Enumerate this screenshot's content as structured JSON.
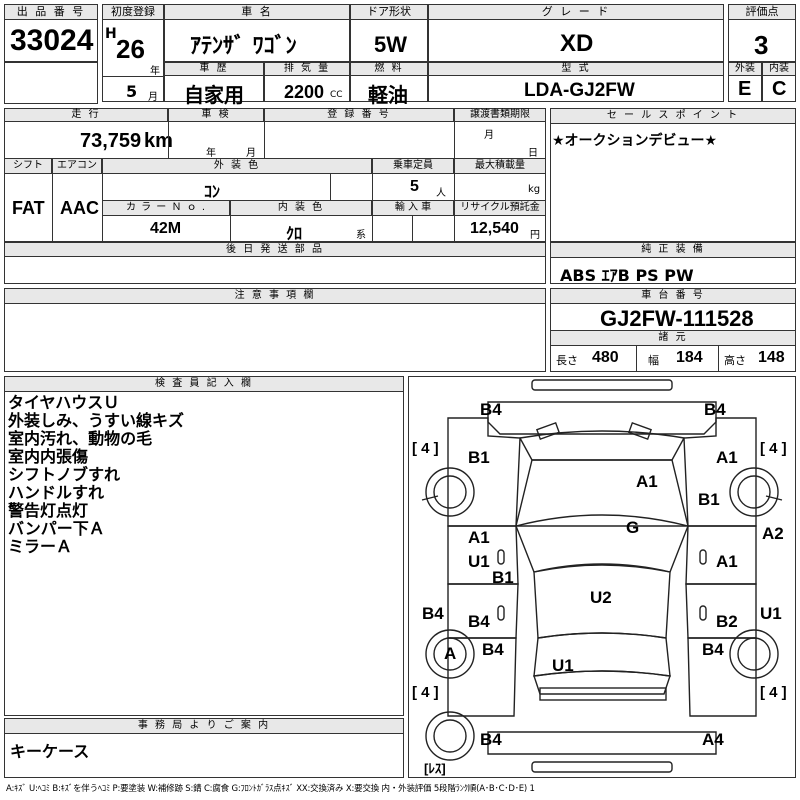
{
  "header": {
    "lot_label": "出 品 番 号",
    "lot": "33024",
    "first_reg_label": "初度登録",
    "era": "H",
    "year": "26",
    "year_unit": "年",
    "month": "5",
    "month_unit": "月",
    "car_name_label": "車 名",
    "car_name": "ｱﾃﾝｻﾞ ﾜｺﾞﾝ",
    "door_label": "ドア形状",
    "door": "5W",
    "grade_label": "グ レ ー ド",
    "grade": "XD",
    "score_label": "評価点",
    "score": "3",
    "history_label": "車 歴",
    "history": "自家用",
    "displacement_label": "排 気 量",
    "displacement": "2200",
    "displacement_unit": "CC",
    "fuel_label": "燃 料",
    "fuel": "軽油",
    "model_label": "型 式",
    "model": "LDA-GJ2FW",
    "ext_label": "外装",
    "ext": "E",
    "int_label": "内装",
    "int": "C"
  },
  "row2": {
    "mileage_label": "走 行",
    "mileage": "73,759",
    "mileage_unit": "km",
    "inspection_label": "車 検",
    "insp_year": "年",
    "insp_month": "月",
    "reg_no_label": "登 録 番 号",
    "transfer_label": "譲渡書類期限",
    "transfer_month": "月",
    "transfer_day": "日",
    "sales_point_label": "セ ー ル ス ポ イ ン ト",
    "sales_point": "★オークションデビュー★",
    "shift_label": "シフト",
    "shift": "FAT",
    "ac_label": "エアコン",
    "ac": "AAC",
    "color_label": "外 装 色",
    "color": "ｺﾝ",
    "capacity_label": "乗車定員",
    "capacity": "5",
    "capacity_unit": "人",
    "load_label": "最大積載量",
    "load_unit": "kg",
    "color_no_label": "カ ラ ー Ｎ ｏ .",
    "color_no": "42M",
    "int_color_label": "内 装 色",
    "int_color": "ｸﾛ",
    "int_color_unit": "系",
    "import_label": "輸 入 車",
    "recycle_label": "リサイクル預託金",
    "recycle": "12,540",
    "recycle_unit": "円"
  },
  "later_parts_label": "後 日 発 送 部 品",
  "equipment_label": "純 正 装 備",
  "equipment": "ABS ｴｱB PS PW",
  "caution_label": "注 意 事 項 欄",
  "chassis_label": "車 台 番 号",
  "chassis": "GJ2FW-111528",
  "dims": {
    "label": "諸 元",
    "length_label": "長さ",
    "length": "480",
    "width_label": "幅",
    "width": "184",
    "height_label": "高さ",
    "height": "148"
  },
  "inspector_label": "検 査 員 記 入 欄",
  "inspector_notes": [
    "タイヤハウスＵ",
    "外装しみ、うすい線キズ",
    "室内汚れ、動物の毛",
    "室内内張傷",
    "シフトノブすれ",
    "ハンドルすれ",
    "警告灯点灯",
    "バンパー下Ａ",
    "ミラーＡ"
  ],
  "office_label": "事 務 局 よ り ご 案 内",
  "office_note": "キーケース",
  "legend": "A:ｷｽﾞ U:ﾍｺﾐ B:ｷｽﾞを伴うﾍｺﾐ P:要塗装 W:補修跡 S:錆 C:腐食 G:ﾌﾛﾝﾄｶﾞﾗｽ点ｷｽﾞ XX:交換済み X:要交換 内・外装評価 5段階ﾗﾝｸ順(A･B･C･D･E) 1",
  "diagram": {
    "tire_fl": "[ 4 ]",
    "tire_fr": "[ 4 ]",
    "tire_rl": "[ 4 ]",
    "tire_rr": "[ 4 ]",
    "spare": "[ﾚｽ]",
    "marks": {
      "b4_tl": "B4",
      "b4_tr": "B4",
      "b1_l": "B1",
      "a1_r": "A1",
      "a1_hood": "A1",
      "b1_r": "B1",
      "g": "G",
      "a1_ld": "A1",
      "u1_ld": "U1",
      "b1_ld": "B1",
      "a2_r": "A2",
      "a1_rd": "A1",
      "b4_l": "B4",
      "b4_ld2": "B4",
      "u2": "U2",
      "b2": "B2",
      "u1_r": "U1",
      "a_tire": "A",
      "b4_lr": "B4",
      "b4_rr": "B4",
      "u1_trunk": "U1",
      "b4_bl": "B4",
      "a4_br": "A4"
    }
  }
}
